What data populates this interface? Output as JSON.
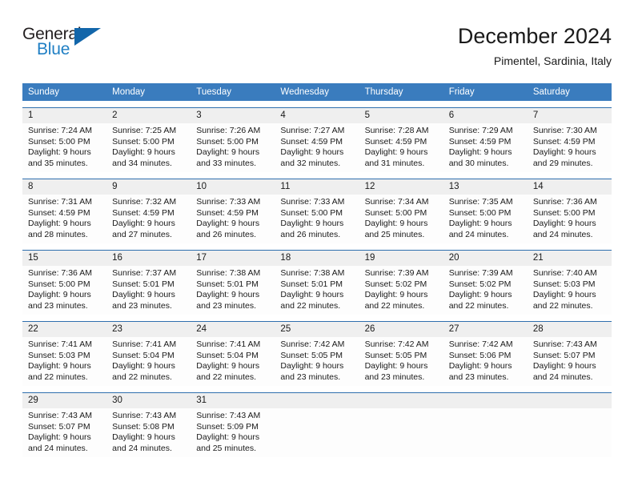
{
  "brand": {
    "name_top": "General",
    "name_bottom": "Blue",
    "accent_color": "#1266aa"
  },
  "header": {
    "title": "December 2024",
    "location": "Pimentel, Sardinia, Italy"
  },
  "theme": {
    "header_row_bg": "#3a7cbe",
    "daynum_bg": "#efefef",
    "week_border": "#2f6fae"
  },
  "weekdays": [
    "Sunday",
    "Monday",
    "Tuesday",
    "Wednesday",
    "Thursday",
    "Friday",
    "Saturday"
  ],
  "weeks": [
    [
      {
        "day": "1",
        "sunrise": "Sunrise: 7:24 AM",
        "sunset": "Sunset: 5:00 PM",
        "daylight1": "Daylight: 9 hours",
        "daylight2": "and 35 minutes."
      },
      {
        "day": "2",
        "sunrise": "Sunrise: 7:25 AM",
        "sunset": "Sunset: 5:00 PM",
        "daylight1": "Daylight: 9 hours",
        "daylight2": "and 34 minutes."
      },
      {
        "day": "3",
        "sunrise": "Sunrise: 7:26 AM",
        "sunset": "Sunset: 5:00 PM",
        "daylight1": "Daylight: 9 hours",
        "daylight2": "and 33 minutes."
      },
      {
        "day": "4",
        "sunrise": "Sunrise: 7:27 AM",
        "sunset": "Sunset: 4:59 PM",
        "daylight1": "Daylight: 9 hours",
        "daylight2": "and 32 minutes."
      },
      {
        "day": "5",
        "sunrise": "Sunrise: 7:28 AM",
        "sunset": "Sunset: 4:59 PM",
        "daylight1": "Daylight: 9 hours",
        "daylight2": "and 31 minutes."
      },
      {
        "day": "6",
        "sunrise": "Sunrise: 7:29 AM",
        "sunset": "Sunset: 4:59 PM",
        "daylight1": "Daylight: 9 hours",
        "daylight2": "and 30 minutes."
      },
      {
        "day": "7",
        "sunrise": "Sunrise: 7:30 AM",
        "sunset": "Sunset: 4:59 PM",
        "daylight1": "Daylight: 9 hours",
        "daylight2": "and 29 minutes."
      }
    ],
    [
      {
        "day": "8",
        "sunrise": "Sunrise: 7:31 AM",
        "sunset": "Sunset: 4:59 PM",
        "daylight1": "Daylight: 9 hours",
        "daylight2": "and 28 minutes."
      },
      {
        "day": "9",
        "sunrise": "Sunrise: 7:32 AM",
        "sunset": "Sunset: 4:59 PM",
        "daylight1": "Daylight: 9 hours",
        "daylight2": "and 27 minutes."
      },
      {
        "day": "10",
        "sunrise": "Sunrise: 7:33 AM",
        "sunset": "Sunset: 4:59 PM",
        "daylight1": "Daylight: 9 hours",
        "daylight2": "and 26 minutes."
      },
      {
        "day": "11",
        "sunrise": "Sunrise: 7:33 AM",
        "sunset": "Sunset: 5:00 PM",
        "daylight1": "Daylight: 9 hours",
        "daylight2": "and 26 minutes."
      },
      {
        "day": "12",
        "sunrise": "Sunrise: 7:34 AM",
        "sunset": "Sunset: 5:00 PM",
        "daylight1": "Daylight: 9 hours",
        "daylight2": "and 25 minutes."
      },
      {
        "day": "13",
        "sunrise": "Sunrise: 7:35 AM",
        "sunset": "Sunset: 5:00 PM",
        "daylight1": "Daylight: 9 hours",
        "daylight2": "and 24 minutes."
      },
      {
        "day": "14",
        "sunrise": "Sunrise: 7:36 AM",
        "sunset": "Sunset: 5:00 PM",
        "daylight1": "Daylight: 9 hours",
        "daylight2": "and 24 minutes."
      }
    ],
    [
      {
        "day": "15",
        "sunrise": "Sunrise: 7:36 AM",
        "sunset": "Sunset: 5:00 PM",
        "daylight1": "Daylight: 9 hours",
        "daylight2": "and 23 minutes."
      },
      {
        "day": "16",
        "sunrise": "Sunrise: 7:37 AM",
        "sunset": "Sunset: 5:01 PM",
        "daylight1": "Daylight: 9 hours",
        "daylight2": "and 23 minutes."
      },
      {
        "day": "17",
        "sunrise": "Sunrise: 7:38 AM",
        "sunset": "Sunset: 5:01 PM",
        "daylight1": "Daylight: 9 hours",
        "daylight2": "and 23 minutes."
      },
      {
        "day": "18",
        "sunrise": "Sunrise: 7:38 AM",
        "sunset": "Sunset: 5:01 PM",
        "daylight1": "Daylight: 9 hours",
        "daylight2": "and 22 minutes."
      },
      {
        "day": "19",
        "sunrise": "Sunrise: 7:39 AM",
        "sunset": "Sunset: 5:02 PM",
        "daylight1": "Daylight: 9 hours",
        "daylight2": "and 22 minutes."
      },
      {
        "day": "20",
        "sunrise": "Sunrise: 7:39 AM",
        "sunset": "Sunset: 5:02 PM",
        "daylight1": "Daylight: 9 hours",
        "daylight2": "and 22 minutes."
      },
      {
        "day": "21",
        "sunrise": "Sunrise: 7:40 AM",
        "sunset": "Sunset: 5:03 PM",
        "daylight1": "Daylight: 9 hours",
        "daylight2": "and 22 minutes."
      }
    ],
    [
      {
        "day": "22",
        "sunrise": "Sunrise: 7:41 AM",
        "sunset": "Sunset: 5:03 PM",
        "daylight1": "Daylight: 9 hours",
        "daylight2": "and 22 minutes."
      },
      {
        "day": "23",
        "sunrise": "Sunrise: 7:41 AM",
        "sunset": "Sunset: 5:04 PM",
        "daylight1": "Daylight: 9 hours",
        "daylight2": "and 22 minutes."
      },
      {
        "day": "24",
        "sunrise": "Sunrise: 7:41 AM",
        "sunset": "Sunset: 5:04 PM",
        "daylight1": "Daylight: 9 hours",
        "daylight2": "and 22 minutes."
      },
      {
        "day": "25",
        "sunrise": "Sunrise: 7:42 AM",
        "sunset": "Sunset: 5:05 PM",
        "daylight1": "Daylight: 9 hours",
        "daylight2": "and 23 minutes."
      },
      {
        "day": "26",
        "sunrise": "Sunrise: 7:42 AM",
        "sunset": "Sunset: 5:05 PM",
        "daylight1": "Daylight: 9 hours",
        "daylight2": "and 23 minutes."
      },
      {
        "day": "27",
        "sunrise": "Sunrise: 7:42 AM",
        "sunset": "Sunset: 5:06 PM",
        "daylight1": "Daylight: 9 hours",
        "daylight2": "and 23 minutes."
      },
      {
        "day": "28",
        "sunrise": "Sunrise: 7:43 AM",
        "sunset": "Sunset: 5:07 PM",
        "daylight1": "Daylight: 9 hours",
        "daylight2": "and 24 minutes."
      }
    ],
    [
      {
        "day": "29",
        "sunrise": "Sunrise: 7:43 AM",
        "sunset": "Sunset: 5:07 PM",
        "daylight1": "Daylight: 9 hours",
        "daylight2": "and 24 minutes."
      },
      {
        "day": "30",
        "sunrise": "Sunrise: 7:43 AM",
        "sunset": "Sunset: 5:08 PM",
        "daylight1": "Daylight: 9 hours",
        "daylight2": "and 24 minutes."
      },
      {
        "day": "31",
        "sunrise": "Sunrise: 7:43 AM",
        "sunset": "Sunset: 5:09 PM",
        "daylight1": "Daylight: 9 hours",
        "daylight2": "and 25 minutes."
      },
      {
        "day": "",
        "sunrise": "",
        "sunset": "",
        "daylight1": "",
        "daylight2": ""
      },
      {
        "day": "",
        "sunrise": "",
        "sunset": "",
        "daylight1": "",
        "daylight2": ""
      },
      {
        "day": "",
        "sunrise": "",
        "sunset": "",
        "daylight1": "",
        "daylight2": ""
      },
      {
        "day": "",
        "sunrise": "",
        "sunset": "",
        "daylight1": "",
        "daylight2": ""
      }
    ]
  ]
}
